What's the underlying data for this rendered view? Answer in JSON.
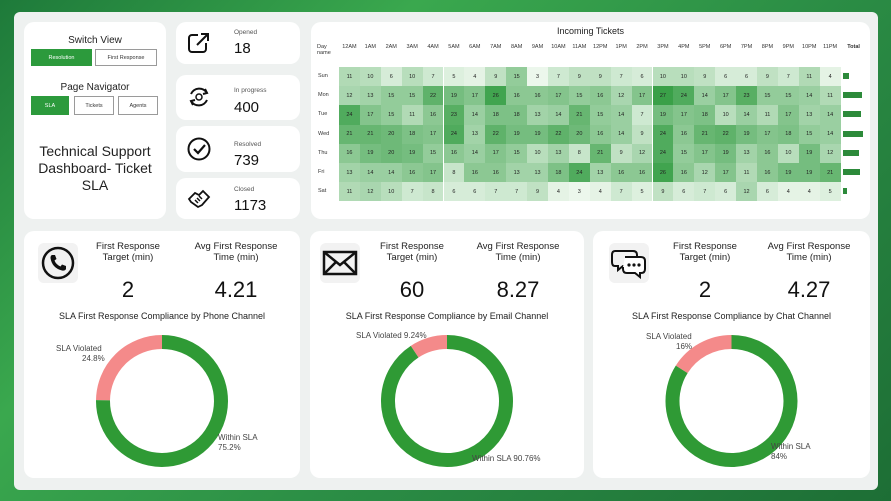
{
  "switch_view": {
    "title": "Switch View",
    "options": [
      "Resolution",
      "First Response"
    ],
    "selected": "Resolution"
  },
  "page_navigator": {
    "title": "Page Navigator",
    "options": [
      "SLA",
      "Tickets",
      "Agents"
    ],
    "selected": "SLA"
  },
  "dashboard_title": "Technical Support Dashboard- Ticket SLA",
  "kpis": [
    {
      "label": "Opened",
      "value": "18",
      "icon": "external-link-icon"
    },
    {
      "label": "In progress",
      "value": "400",
      "icon": "refresh-cycle-icon"
    },
    {
      "label": "Resolved",
      "value": "739",
      "icon": "check-circle-icon"
    },
    {
      "label": "Closed",
      "value": "1173",
      "icon": "handshake-icon"
    }
  ],
  "heatmap": {
    "title": "Incoming Tickets",
    "corner_label": "Day name",
    "total_label": "Total",
    "hours": [
      "12AM",
      "1AM",
      "2AM",
      "3AM",
      "4AM",
      "5AM",
      "6AM",
      "7AM",
      "8AM",
      "9AM",
      "10AM",
      "11AM",
      "12PM",
      "1PM",
      "2PM",
      "3PM",
      "4PM",
      "5PM",
      "6PM",
      "7PM",
      "8PM",
      "9PM",
      "10PM",
      "11PM"
    ],
    "days": [
      "Sun",
      "Mon",
      "Tue",
      "Wed",
      "Thu",
      "Fri",
      "Sat"
    ],
    "values": [
      [
        11,
        10,
        6,
        10,
        7,
        5,
        4,
        9,
        15,
        3,
        7,
        9,
        9,
        7,
        6,
        10,
        10,
        9,
        6,
        6,
        9,
        7,
        11,
        4
      ],
      [
        12,
        13,
        15,
        15,
        22,
        19,
        17,
        26,
        16,
        16,
        17,
        15,
        16,
        12,
        17,
        27,
        24,
        14,
        17,
        23,
        15,
        15,
        14,
        11
      ],
      [
        24,
        17,
        15,
        11,
        16,
        23,
        14,
        18,
        18,
        13,
        14,
        21,
        15,
        14,
        7,
        19,
        17,
        18,
        10,
        14,
        11,
        17,
        13,
        14
      ],
      [
        21,
        21,
        20,
        18,
        17,
        24,
        13,
        22,
        19,
        19,
        22,
        20,
        16,
        14,
        9,
        24,
        16,
        21,
        22,
        19,
        17,
        18,
        15,
        14
      ],
      [
        16,
        19,
        20,
        19,
        15,
        16,
        14,
        17,
        15,
        10,
        13,
        8,
        21,
        9,
        12,
        24,
        15,
        17,
        19,
        13,
        16,
        10,
        19,
        12
      ],
      [
        13,
        14,
        14,
        16,
        17,
        8,
        16,
        16,
        13,
        13,
        18,
        24,
        13,
        16,
        16,
        26,
        16,
        12,
        17,
        11,
        16,
        19,
        19,
        21
      ],
      [
        11,
        12,
        10,
        7,
        8,
        6,
        6,
        7,
        7,
        9,
        4,
        3,
        4,
        7,
        5,
        9,
        6,
        7,
        6,
        12,
        6,
        4,
        4,
        5
      ]
    ],
    "totals": [
      7,
      20,
      19,
      21,
      17,
      18,
      5
    ]
  },
  "channels": [
    {
      "name": "Phone",
      "icon": "phone-icon",
      "target_label": "First Response Target (min)",
      "target_value": "2",
      "avg_label": "Avg First Response Time (min)",
      "avg_value": "4.21",
      "chart_title": "SLA First Response Compliance by Phone Channel",
      "violated_label": "SLA Violated",
      "violated_value": "24.8%",
      "within_label": "Within SLA",
      "within_value": "75.2%"
    },
    {
      "name": "Email",
      "icon": "envelope-icon",
      "target_label": "First Response Target (min)",
      "target_value": "60",
      "avg_label": "Avg First Response Time (min)",
      "avg_value": "8.27",
      "chart_title": "SLA First Response Compliance by Email Channel",
      "violated_label": "SLA Violated",
      "violated_value": "9.24%",
      "within_label": "Within SLA",
      "within_value": "90.76%"
    },
    {
      "name": "Chat",
      "icon": "chat-bubbles-icon",
      "target_label": "First Response Target (min)",
      "target_value": "2",
      "avg_label": "Avg First Response Time (min)",
      "avg_value": "4.27",
      "chart_title": "SLA First Response Compliance by Chat Channel",
      "violated_label": "SLA Violated",
      "violated_value": "16%",
      "within_label": "Within SLA",
      "within_value": "84%"
    }
  ],
  "chart_data": [
    {
      "type": "pie",
      "title": "SLA First Response Compliance by Phone Channel",
      "categories": [
        "SLA Violated",
        "Within SLA"
      ],
      "values": [
        24.8,
        75.2
      ]
    },
    {
      "type": "pie",
      "title": "SLA First Response Compliance by Email Channel",
      "categories": [
        "SLA Violated",
        "Within SLA"
      ],
      "values": [
        9.24,
        90.76
      ]
    },
    {
      "type": "pie",
      "title": "SLA First Response Compliance by Chat Channel",
      "categories": [
        "SLA Violated",
        "Within SLA"
      ],
      "values": [
        16,
        84
      ]
    }
  ],
  "colors": {
    "accent": "#2c9a3c",
    "violated": "#f48a8a",
    "within": "#2f9a35"
  }
}
